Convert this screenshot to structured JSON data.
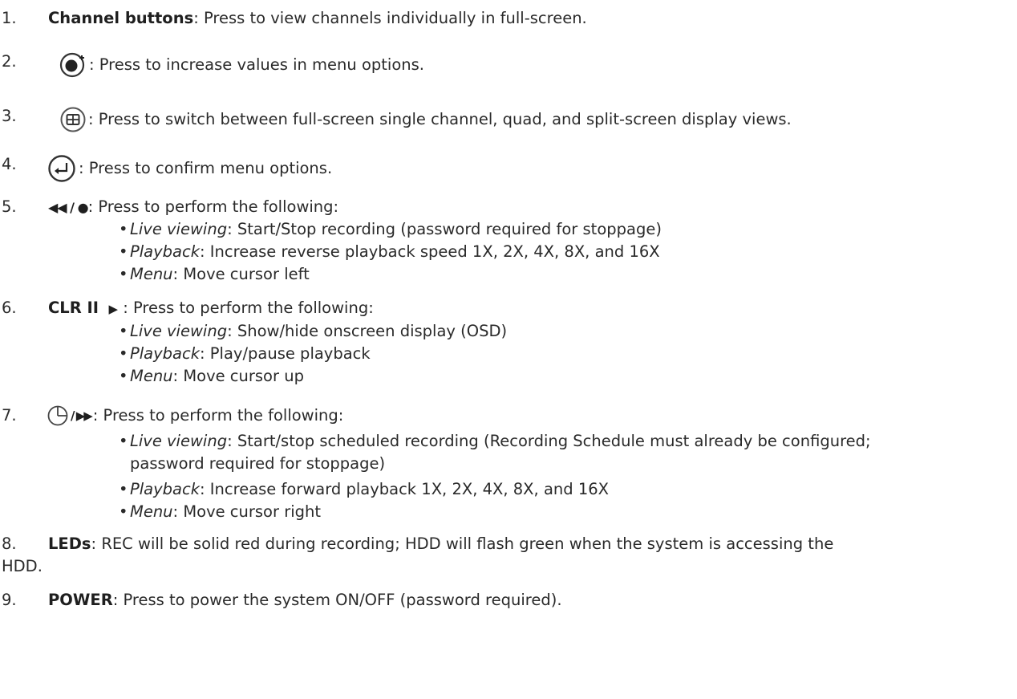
{
  "items": [
    {
      "num": "1.",
      "bold": "Channel buttons",
      "text": ": Press to view channels individually in full-screen."
    },
    {
      "num": "2.",
      "icon": "plus-circle-icon",
      "text": ": Press to increase values in menu options."
    },
    {
      "num": "3.",
      "icon": "split-screen-icon",
      "text": ": Press to switch between full-screen single channel, quad, and split-screen display views."
    },
    {
      "num": "4.",
      "icon": "enter-icon",
      "text": ": Press to confirm menu options."
    },
    {
      "num": "5.",
      "label": "◀◀ / ●",
      "text": ": Press to perform the following:",
      "bullets": [
        {
          "term": "Live viewing",
          "text": ": Start/Stop recording (password required for stoppage)"
        },
        {
          "term": "Playback",
          "text": ": Increase reverse playback speed 1X, 2X, 4X, 8X, and 16X"
        },
        {
          "term": "Menu",
          "text": ": Move cursor left"
        }
      ]
    },
    {
      "num": "6.",
      "bold": "CLR II",
      "label": "▶",
      "text": ": Press to perform the following:",
      "bullets": [
        {
          "term": "Live viewing",
          "text": ": Show/hide onscreen display (OSD)"
        },
        {
          "term": "Playback",
          "text": ": Play/pause playback"
        },
        {
          "term": "Menu",
          "text": ": Move cursor up"
        }
      ]
    },
    {
      "num": "7.",
      "icon": "clock-icon",
      "label": "/ ▶▶",
      "text": ": Press to perform the following:",
      "bullets": [
        {
          "term": "Live viewing",
          "text": ": Start/stop scheduled recording (Recording Schedule must already be configured;",
          "cont": "password required for stoppage)"
        },
        {
          "term": "Playback",
          "text": ": Increase forward playback 1X, 2X, 4X, 8X, and 16X"
        },
        {
          "term": "Menu",
          "text": ": Move cursor right"
        }
      ]
    },
    {
      "num": "8.",
      "bold": "LEDs",
      "text": ": REC will be solid red during recording; HDD will flash green when the system is accessing the",
      "cont": "HDD."
    },
    {
      "num": "9.",
      "bold": "POWER",
      "text": ": Press to power the system ON/OFF (password required)."
    }
  ]
}
